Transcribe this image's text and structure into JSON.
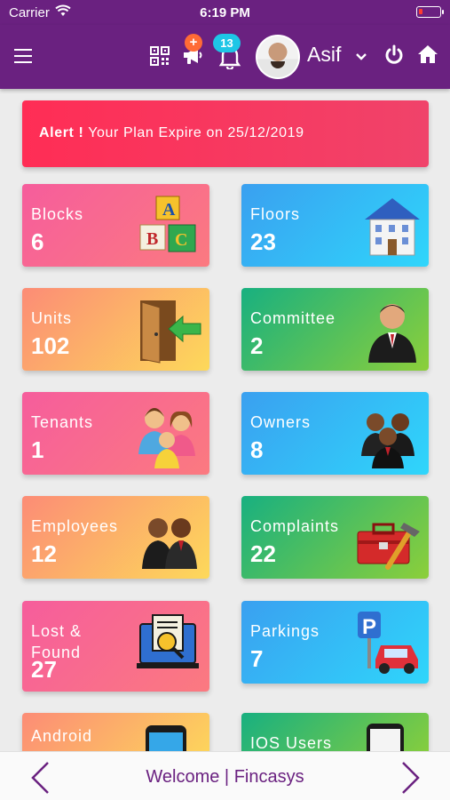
{
  "status_bar": {
    "carrier": "Carrier",
    "time": "6:19 PM"
  },
  "header": {
    "notification_badge": "+",
    "bell_count": "13",
    "user_name": "Asif"
  },
  "alert": {
    "prefix": "Alert !",
    "message": "Your Plan Expire on 25/12/2019"
  },
  "cards": [
    {
      "label": "Blocks",
      "count": "6",
      "icon": "abc-blocks-icon"
    },
    {
      "label": "Floors",
      "count": "23",
      "icon": "building-icon"
    },
    {
      "label": "Units",
      "count": "102",
      "icon": "door-enter-icon"
    },
    {
      "label": "Committee",
      "count": "2",
      "icon": "businessman-icon"
    },
    {
      "label": "Tenants",
      "count": "1",
      "icon": "family-icon"
    },
    {
      "label": "Owners",
      "count": "8",
      "icon": "people-group-icon"
    },
    {
      "label": "Employees",
      "count": "12",
      "icon": "employees-icon"
    },
    {
      "label": "Complaints",
      "count": "22",
      "icon": "toolbox-icon"
    },
    {
      "label": "Lost & Found",
      "count": "27",
      "icon": "lost-found-icon"
    },
    {
      "label": "Parkings",
      "count": "7",
      "icon": "parking-icon"
    },
    {
      "label": "Android",
      "count": "",
      "icon": "android-phone-icon"
    },
    {
      "label": "IOS Users",
      "count": "",
      "icon": "ios-phone-icon"
    }
  ],
  "footer": {
    "welcome_text": "Welcome | Fincasys"
  },
  "colors": {
    "primary": "#6a2180",
    "alert": "#ff2d55",
    "accent_badge": "#1ec6e6"
  }
}
